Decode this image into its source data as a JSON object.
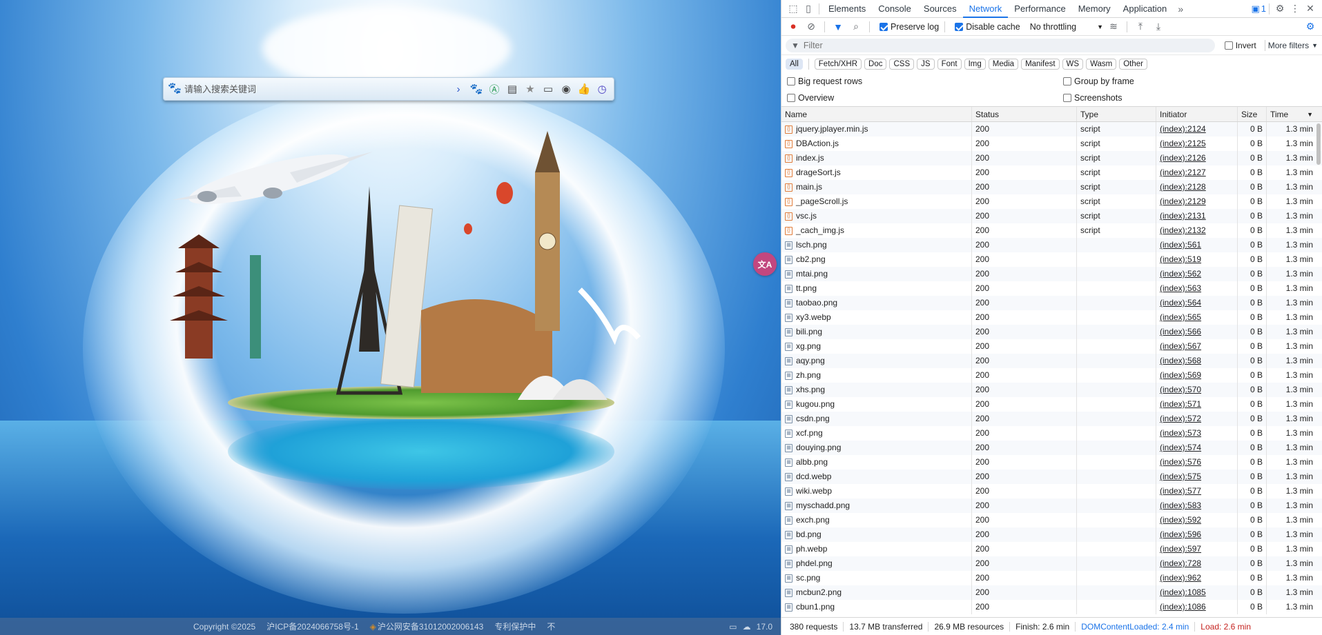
{
  "page": {
    "search_placeholder": "请输入搜索关键词",
    "search_icons": [
      "arrow-right-icon",
      "baidu-paw-icon",
      "android-icon",
      "list-icon",
      "star-icon",
      "monitor-icon",
      "record-icon",
      "thumb-up-icon",
      "clock-search-icon"
    ],
    "translate_label": "文A",
    "footer": {
      "copyright": "Copyright ©2025",
      "icp": "沪ICP备2024066758号-1",
      "police": "沪公网安备31012002006143",
      "patent": "专利保护中",
      "extra": "不",
      "temperature": "17.0"
    }
  },
  "devtools": {
    "tabs": [
      "Elements",
      "Console",
      "Sources",
      "Network",
      "Performance",
      "Memory",
      "Application"
    ],
    "active_tab": "Network",
    "issue_count": "1",
    "toolbar": {
      "preserve_log": "Preserve log",
      "disable_cache": "Disable cache",
      "throttling": "No throttling"
    },
    "filter": {
      "placeholder": "Filter",
      "invert": "Invert",
      "more_filters": "More filters"
    },
    "type_filters": [
      "All",
      "Fetch/XHR",
      "Doc",
      "CSS",
      "JS",
      "Font",
      "Img",
      "Media",
      "Manifest",
      "WS",
      "Wasm",
      "Other"
    ],
    "options": {
      "big_rows": "Big request rows",
      "group_by_frame": "Group by frame",
      "overview": "Overview",
      "screenshots": "Screenshots"
    },
    "columns": {
      "name": "Name",
      "status": "Status",
      "type": "Type",
      "initiator": "Initiator",
      "size": "Size",
      "time": "Time"
    },
    "rows": [
      {
        "name": "jquery.jplayer.min.js",
        "status": "200",
        "type": "script",
        "initiator": "(index):2124",
        "size": "0 B",
        "time": "1.3 min",
        "kind": "js"
      },
      {
        "name": "DBAction.js",
        "status": "200",
        "type": "script",
        "initiator": "(index):2125",
        "size": "0 B",
        "time": "1.3 min",
        "kind": "js"
      },
      {
        "name": "index.js",
        "status": "200",
        "type": "script",
        "initiator": "(index):2126",
        "size": "0 B",
        "time": "1.3 min",
        "kind": "js"
      },
      {
        "name": "drageSort.js",
        "status": "200",
        "type": "script",
        "initiator": "(index):2127",
        "size": "0 B",
        "time": "1.3 min",
        "kind": "js"
      },
      {
        "name": "main.js",
        "status": "200",
        "type": "script",
        "initiator": "(index):2128",
        "size": "0 B",
        "time": "1.3 min",
        "kind": "js"
      },
      {
        "name": "_pageScroll.js",
        "status": "200",
        "type": "script",
        "initiator": "(index):2129",
        "size": "0 B",
        "time": "1.3 min",
        "kind": "js"
      },
      {
        "name": "vsc.js",
        "status": "200",
        "type": "script",
        "initiator": "(index):2131",
        "size": "0 B",
        "time": "1.3 min",
        "kind": "js"
      },
      {
        "name": "_cach_img.js",
        "status": "200",
        "type": "script",
        "initiator": "(index):2132",
        "size": "0 B",
        "time": "1.3 min",
        "kind": "js"
      },
      {
        "name": "lsch.png",
        "status": "200",
        "type": "",
        "initiator": "(index):561",
        "size": "0 B",
        "time": "1.3 min",
        "kind": "img"
      },
      {
        "name": "cb2.png",
        "status": "200",
        "type": "",
        "initiator": "(index):519",
        "size": "0 B",
        "time": "1.3 min",
        "kind": "img"
      },
      {
        "name": "mtai.png",
        "status": "200",
        "type": "",
        "initiator": "(index):562",
        "size": "0 B",
        "time": "1.3 min",
        "kind": "img"
      },
      {
        "name": "tt.png",
        "status": "200",
        "type": "",
        "initiator": "(index):563",
        "size": "0 B",
        "time": "1.3 min",
        "kind": "img"
      },
      {
        "name": "taobao.png",
        "status": "200",
        "type": "",
        "initiator": "(index):564",
        "size": "0 B",
        "time": "1.3 min",
        "kind": "img"
      },
      {
        "name": "xy3.webp",
        "status": "200",
        "type": "",
        "initiator": "(index):565",
        "size": "0 B",
        "time": "1.3 min",
        "kind": "img"
      },
      {
        "name": "bili.png",
        "status": "200",
        "type": "",
        "initiator": "(index):566",
        "size": "0 B",
        "time": "1.3 min",
        "kind": "img"
      },
      {
        "name": "xg.png",
        "status": "200",
        "type": "",
        "initiator": "(index):567",
        "size": "0 B",
        "time": "1.3 min",
        "kind": "img"
      },
      {
        "name": "aqy.png",
        "status": "200",
        "type": "",
        "initiator": "(index):568",
        "size": "0 B",
        "time": "1.3 min",
        "kind": "img"
      },
      {
        "name": "zh.png",
        "status": "200",
        "type": "",
        "initiator": "(index):569",
        "size": "0 B",
        "time": "1.3 min",
        "kind": "img"
      },
      {
        "name": "xhs.png",
        "status": "200",
        "type": "",
        "initiator": "(index):570",
        "size": "0 B",
        "time": "1.3 min",
        "kind": "img"
      },
      {
        "name": "kugou.png",
        "status": "200",
        "type": "",
        "initiator": "(index):571",
        "size": "0 B",
        "time": "1.3 min",
        "kind": "img"
      },
      {
        "name": "csdn.png",
        "status": "200",
        "type": "",
        "initiator": "(index):572",
        "size": "0 B",
        "time": "1.3 min",
        "kind": "img"
      },
      {
        "name": "xcf.png",
        "status": "200",
        "type": "",
        "initiator": "(index):573",
        "size": "0 B",
        "time": "1.3 min",
        "kind": "img"
      },
      {
        "name": "douying.png",
        "status": "200",
        "type": "",
        "initiator": "(index):574",
        "size": "0 B",
        "time": "1.3 min",
        "kind": "img"
      },
      {
        "name": "albb.png",
        "status": "200",
        "type": "",
        "initiator": "(index):576",
        "size": "0 B",
        "time": "1.3 min",
        "kind": "img"
      },
      {
        "name": "dcd.webp",
        "status": "200",
        "type": "",
        "initiator": "(index):575",
        "size": "0 B",
        "time": "1.3 min",
        "kind": "img"
      },
      {
        "name": "wiki.webp",
        "status": "200",
        "type": "",
        "initiator": "(index):577",
        "size": "0 B",
        "time": "1.3 min",
        "kind": "img"
      },
      {
        "name": "myschadd.png",
        "status": "200",
        "type": "",
        "initiator": "(index):583",
        "size": "0 B",
        "time": "1.3 min",
        "kind": "img"
      },
      {
        "name": "exch.png",
        "status": "200",
        "type": "",
        "initiator": "(index):592",
        "size": "0 B",
        "time": "1.3 min",
        "kind": "img"
      },
      {
        "name": "bd.png",
        "status": "200",
        "type": "",
        "initiator": "(index):596",
        "size": "0 B",
        "time": "1.3 min",
        "kind": "img"
      },
      {
        "name": "ph.webp",
        "status": "200",
        "type": "",
        "initiator": "(index):597",
        "size": "0 B",
        "time": "1.3 min",
        "kind": "img"
      },
      {
        "name": "phdel.png",
        "status": "200",
        "type": "",
        "initiator": "(index):728",
        "size": "0 B",
        "time": "1.3 min",
        "kind": "img"
      },
      {
        "name": "sc.png",
        "status": "200",
        "type": "",
        "initiator": "(index):962",
        "size": "0 B",
        "time": "1.3 min",
        "kind": "img"
      },
      {
        "name": "mcbun2.png",
        "status": "200",
        "type": "",
        "initiator": "(index):1085",
        "size": "0 B",
        "time": "1.3 min",
        "kind": "img"
      },
      {
        "name": "cbun1.png",
        "status": "200",
        "type": "",
        "initiator": "(index):1086",
        "size": "0 B",
        "time": "1.3 min",
        "kind": "img"
      }
    ],
    "summary": {
      "requests": "380 requests",
      "transferred": "13.7 MB transferred",
      "resources": "26.9 MB resources",
      "finish": "Finish: 2.6 min",
      "dom_loaded": "DOMContentLoaded: 2.4 min",
      "load": "Load: 2.6 min"
    },
    "colors": {
      "accent": "#1a73e8",
      "load": "#c5221f",
      "record": "#d93025"
    }
  }
}
